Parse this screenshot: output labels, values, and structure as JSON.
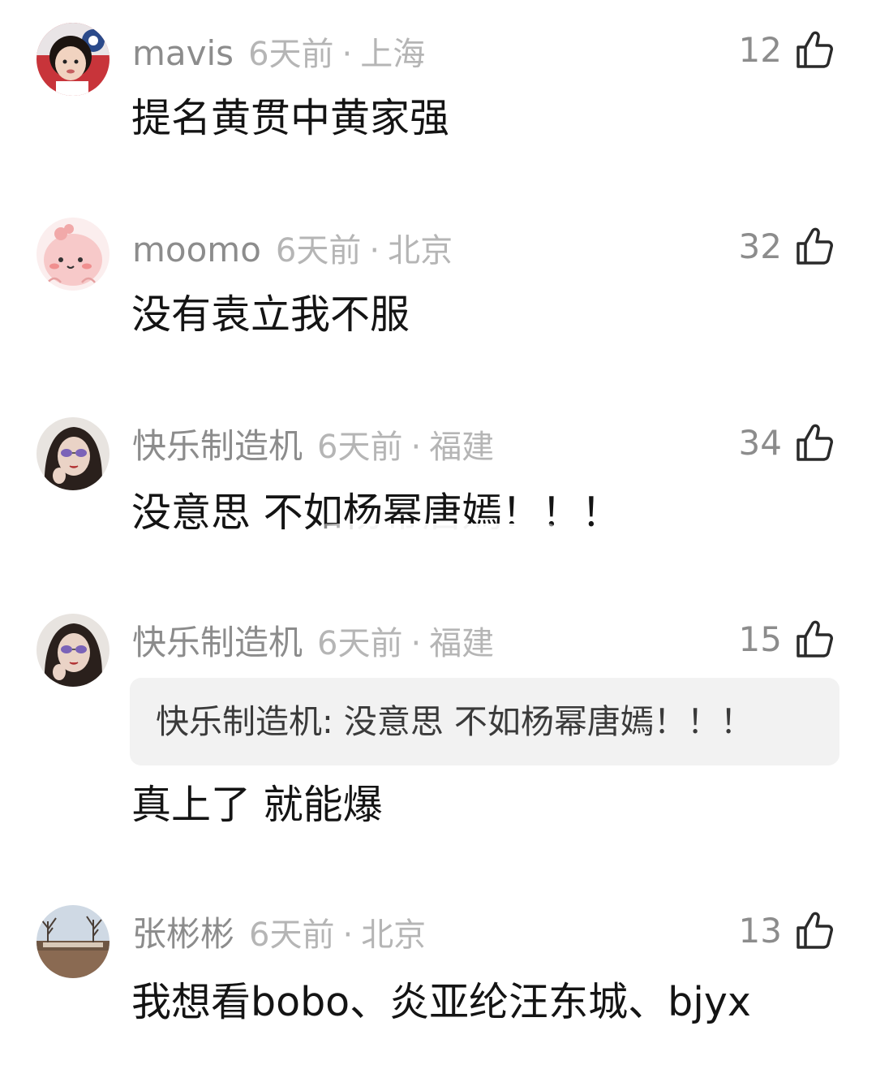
{
  "comments": [
    {
      "username": "mavis",
      "time": "6天前",
      "separator": "·",
      "location": "上海",
      "likes": "12",
      "content": "提名黄贯中黄家强",
      "avatar_icon": "child-photo-avatar"
    },
    {
      "username": "moomo",
      "time": "6天前",
      "separator": "·",
      "location": "北京",
      "likes": "32",
      "content": "没有袁立我不服",
      "avatar_icon": "pink-cartoon-avatar"
    },
    {
      "username": "快乐制造机",
      "time": "6天前",
      "separator": "·",
      "location": "福建",
      "likes": "34",
      "content": "没意思 不如杨幂唐嫣！！！",
      "avatar_icon": "woman-sunglasses-avatar"
    },
    {
      "username": "快乐制造机",
      "time": "6天前",
      "separator": "·",
      "location": "福建",
      "likes": "15",
      "quote": "快乐制造机: 没意思 不如杨幂唐嫣！！！",
      "content": "真上了 就能爆",
      "avatar_icon": "woman-sunglasses-avatar"
    },
    {
      "username": "张彬彬",
      "time": "6天前",
      "separator": "·",
      "location": "北京",
      "likes": "13",
      "content": "我想看bobo、炎亚纶汪东城、bjyx",
      "avatar_icon": "landscape-photo-avatar"
    }
  ],
  "icons": {
    "like": "thumbs-up-icon"
  },
  "colors": {
    "username": "#8c8c8c",
    "meta": "#b5b5b5",
    "content": "#141414",
    "quote_bg": "#f2f2f2"
  }
}
